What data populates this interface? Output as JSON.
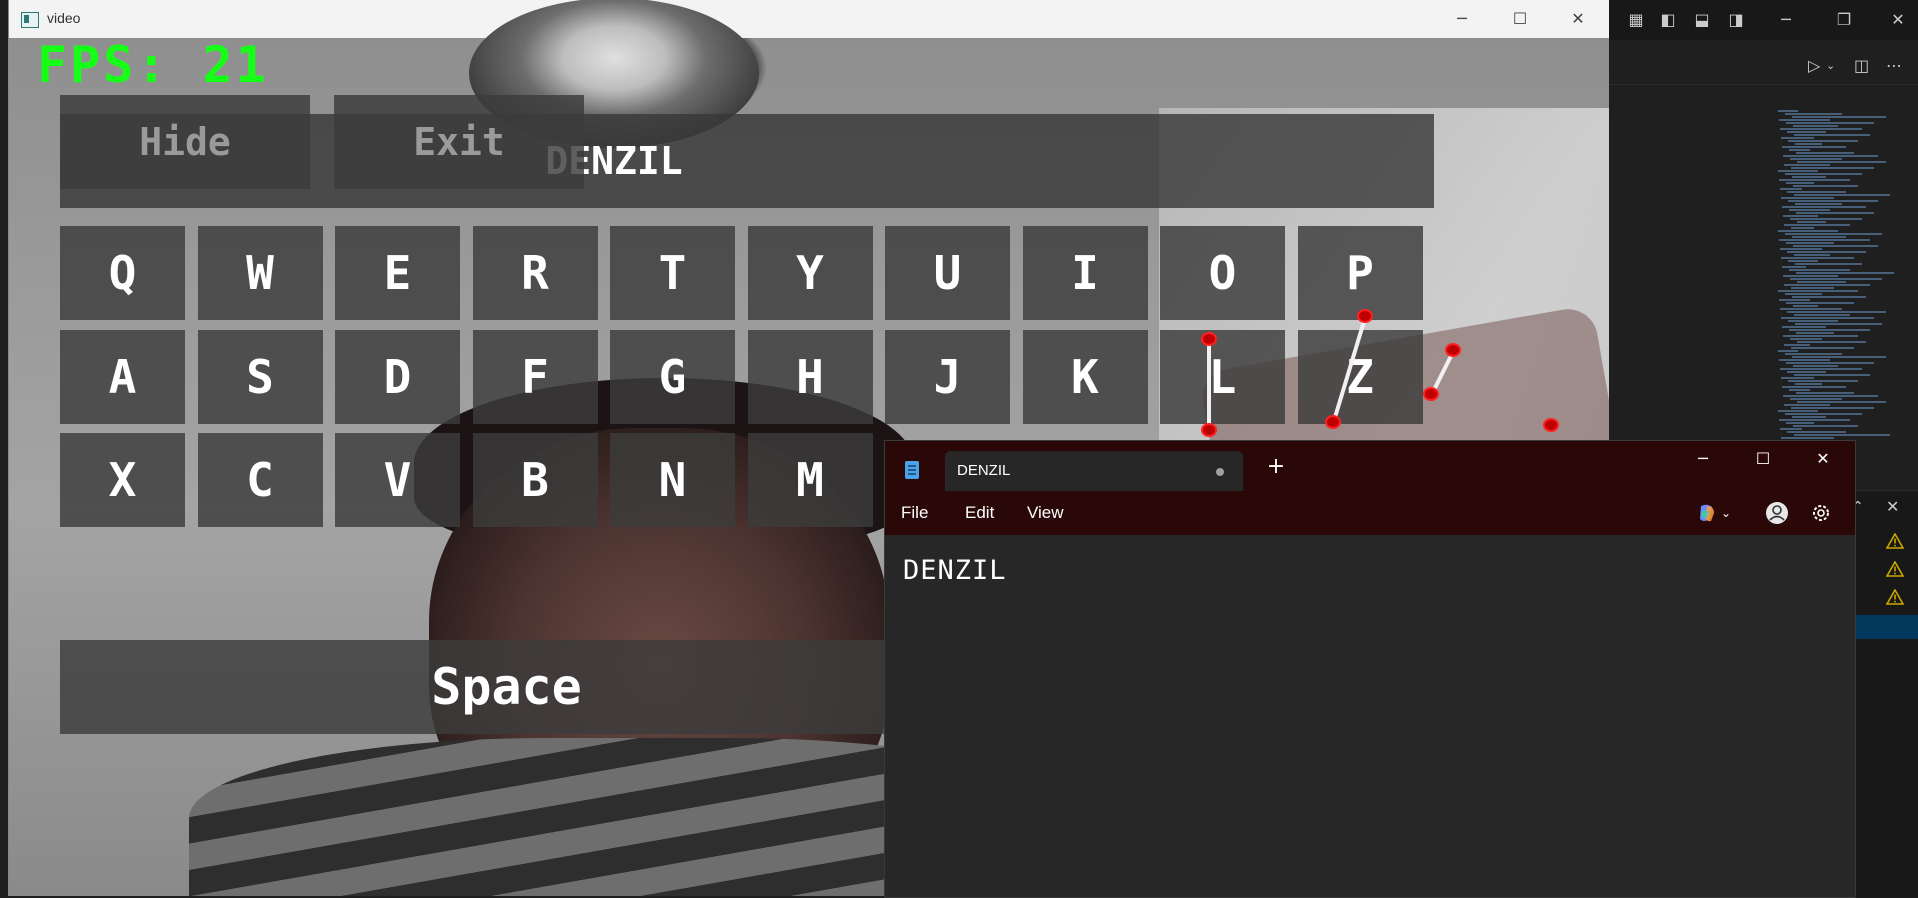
{
  "video_window": {
    "title": "video",
    "fps_label": "FPS: 21",
    "hide_button": "Hide",
    "exit_button": "Exit",
    "typed_text": "DENZIL",
    "keys_row1": [
      "Q",
      "W",
      "E",
      "R",
      "T",
      "Y",
      "U",
      "I",
      "O",
      "P"
    ],
    "keys_row2": [
      "A",
      "S",
      "D",
      "F",
      "G",
      "H",
      "J",
      "K",
      "L",
      "Z"
    ],
    "keys_row3": [
      "X",
      "C",
      "V",
      "B",
      "N",
      "M"
    ],
    "space_label": "Space"
  },
  "notepad": {
    "tab_title": "DENZIL",
    "new_tab_symbol": "+",
    "menu": {
      "file": "File",
      "edit": "Edit",
      "view": "View"
    },
    "content": "DENZIL"
  },
  "colors": {
    "fps_green": "#16ff16",
    "notepad_titlebar": "#2b0808",
    "landmark_red": "#c00000",
    "warning_yellow": "#cca700"
  },
  "icons": {
    "minimize": "minimize-icon",
    "maximize": "maximize-icon",
    "close": "close-icon",
    "run": "play-icon",
    "split": "split-editor-icon",
    "more": "more-icon",
    "copilot": "copilot-icon",
    "account": "account-icon",
    "settings": "gear-icon",
    "warning": "warning-icon"
  }
}
